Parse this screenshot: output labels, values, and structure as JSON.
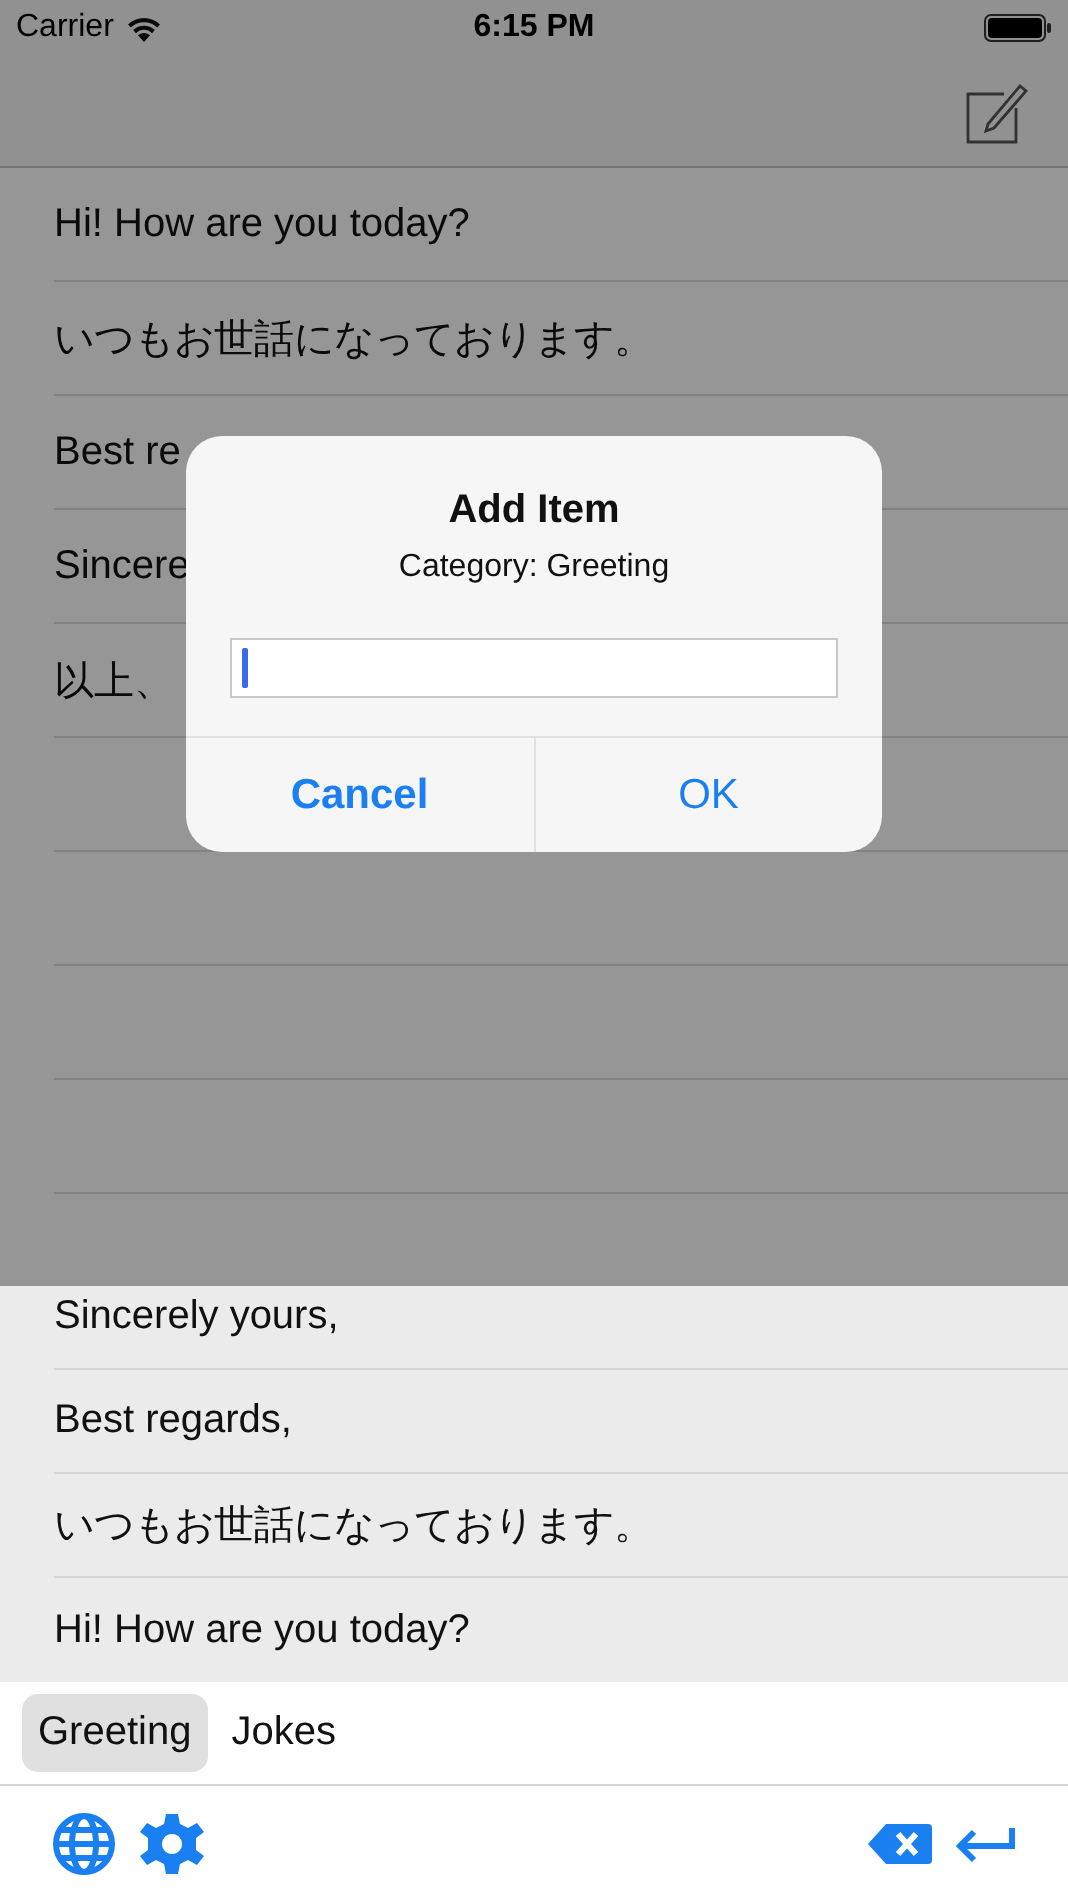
{
  "status_bar": {
    "carrier": "Carrier",
    "time": "6:15 PM"
  },
  "list": {
    "rows": [
      {
        "text": "Hi! How are you today?"
      },
      {
        "text": "いつもお世話になっております。"
      },
      {
        "text": "Best re"
      },
      {
        "text": "Sincere"
      },
      {
        "text": "以上、"
      }
    ]
  },
  "dialog": {
    "title": "Add Item",
    "message": "Category: Greeting",
    "buttons": [
      {
        "label": "Cancel",
        "kind": "cancel"
      },
      {
        "label": "OK",
        "kind": "default"
      }
    ]
  },
  "keyboard": {
    "phrases": [
      {
        "text": "Sincerely yours,"
      },
      {
        "text": "Best regards,"
      },
      {
        "text": "いつもお世話になっております。"
      },
      {
        "text": "Hi! How are you today?"
      }
    ],
    "tabs": [
      {
        "label": "Greeting",
        "selected": true
      },
      {
        "label": "Jokes",
        "selected": false
      }
    ]
  }
}
